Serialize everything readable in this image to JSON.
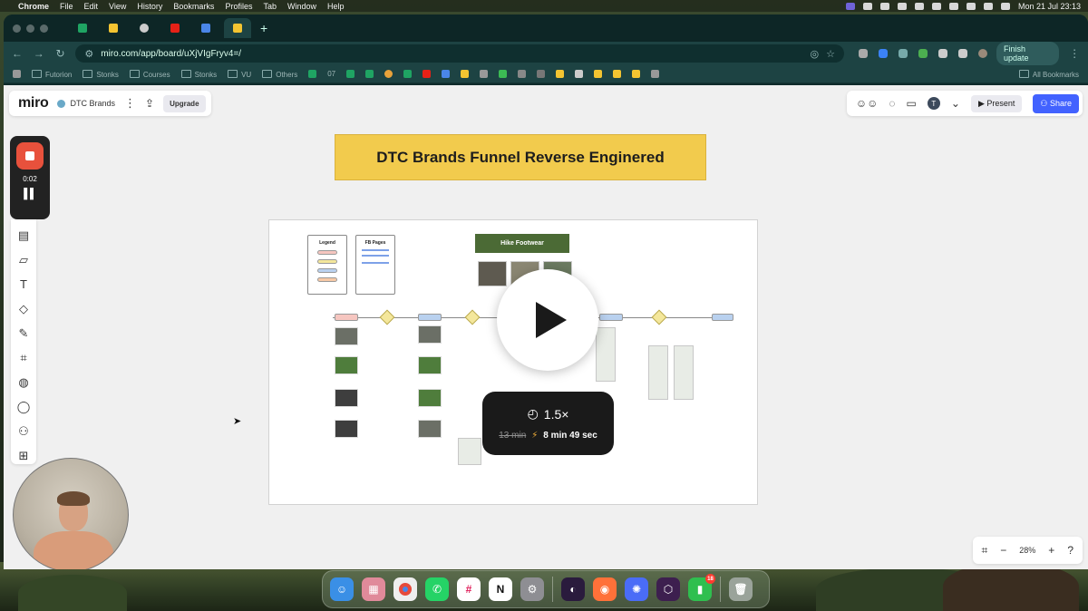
{
  "menubar": {
    "app": "Chrome",
    "items": [
      "File",
      "Edit",
      "View",
      "History",
      "Bookmarks",
      "Profiles",
      "Tab",
      "Window",
      "Help"
    ],
    "datetime": "Mon 21 Jul  23:13"
  },
  "browser": {
    "url": "miro.com/app/board/uXjVIgFryv4=/",
    "finish_update": "Finish update",
    "bookmarks": [
      "Futorion",
      "Stonks",
      "Courses",
      "Stonks",
      "VU",
      "Others",
      "07"
    ],
    "all_bookmarks": "All Bookmarks"
  },
  "miro": {
    "logo": "miro",
    "board_name": "DTC Brands",
    "upgrade": "Upgrade",
    "present": "Present",
    "share": "Share",
    "avatar_initial": "T",
    "zoom_level": "28%"
  },
  "recording": {
    "time": "0:02"
  },
  "board": {
    "banner_title": "DTC Brands Funnel Reverse Enginered",
    "legend_title": "Legend",
    "fb_pages_title": "FB Pages",
    "hike_label": "Hike Footwear"
  },
  "player": {
    "speed": "1.5×",
    "original_duration": "13 min",
    "new_duration": "8 min 49 sec"
  },
  "dock": {
    "notification_count": "18"
  }
}
